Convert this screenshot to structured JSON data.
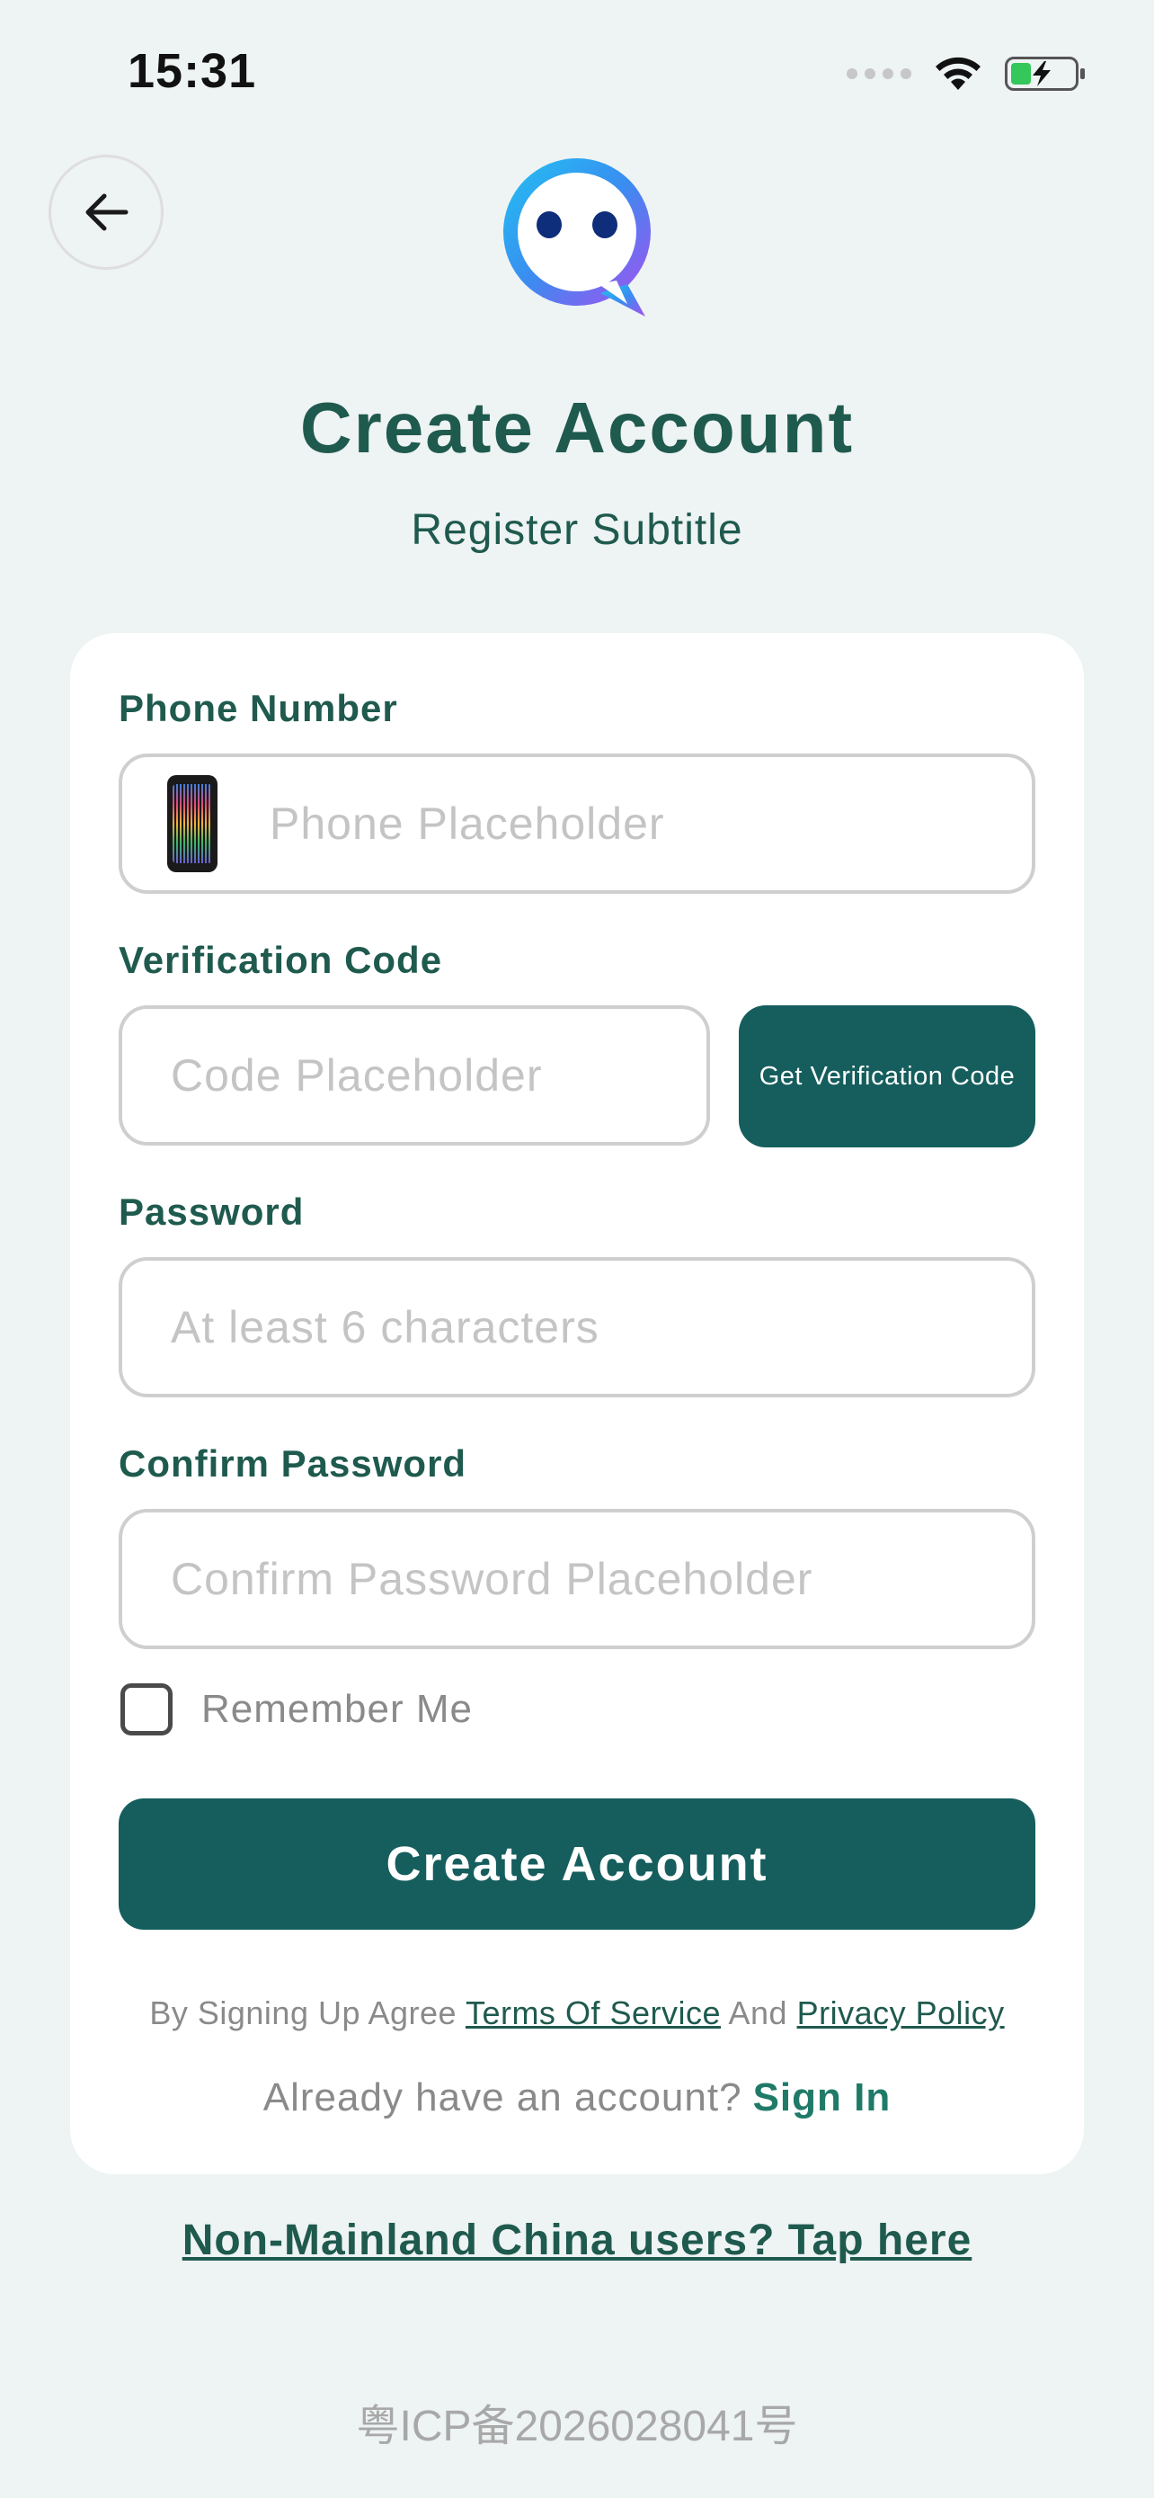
{
  "status_bar": {
    "time": "15:31"
  },
  "header": {
    "title": "Create Account",
    "subtitle": "Register Subtitle"
  },
  "form": {
    "phone": {
      "label": "Phone Number",
      "placeholder": "Phone Placeholder",
      "value": ""
    },
    "code": {
      "label": "Verification Code",
      "placeholder": "Code Placeholder",
      "value": "",
      "button_label": "Get Verification Code"
    },
    "password": {
      "label": "Password",
      "placeholder": "At least 6 characters",
      "value": ""
    },
    "confirm_password": {
      "label": "Confirm Password",
      "placeholder": "Confirm Password Placeholder",
      "value": ""
    },
    "remember_me": {
      "label": "Remember Me",
      "checked": false
    },
    "submit_label": "Create Account"
  },
  "agreement": {
    "prefix": "By Signing Up Agree",
    "terms_link": "Terms Of Service",
    "conjunction": "And",
    "privacy_link": "Privacy Policy"
  },
  "signin": {
    "prompt": "Already have an account?",
    "link": "Sign In"
  },
  "non_mainland_link": "Non-Mainland China users? Tap here",
  "icp_text": "粤ICP备2026028041号",
  "colors": {
    "background": "#eef3f3",
    "primary": "#155e5d",
    "heading": "#1f5a4e",
    "accent_link": "#1f7a68",
    "battery_green": "#34c759"
  }
}
